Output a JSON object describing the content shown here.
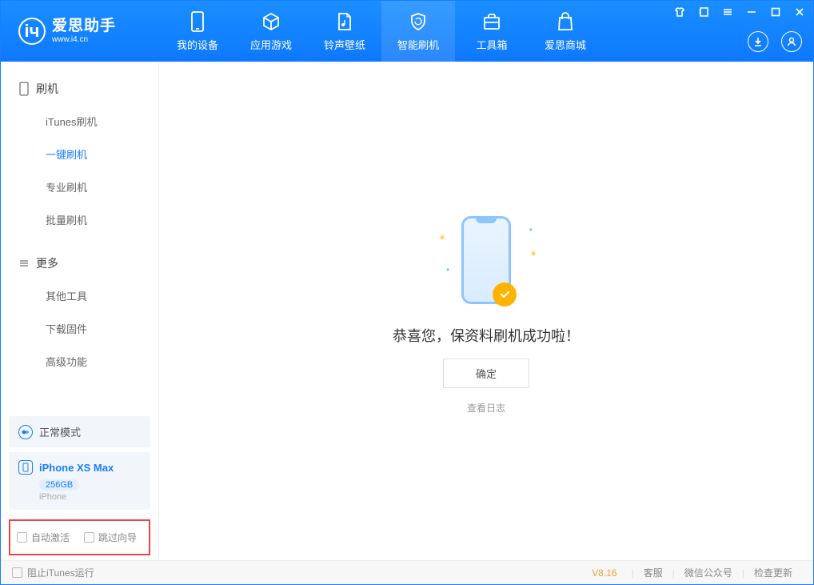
{
  "logo": {
    "title": "爱思助手",
    "sub": "www.i4.cn"
  },
  "tabs": {
    "device": "我的设备",
    "apps": "应用游戏",
    "ringtone": "铃声壁纸",
    "flash": "智能刷机",
    "toolbox": "工具箱",
    "store": "爱思商城"
  },
  "sidebar": {
    "section1_title": "刷机",
    "items1": {
      "itunes": "iTunes刷机",
      "oneclick": "一键刷机",
      "pro": "专业刷机",
      "batch": "批量刷机"
    },
    "section2_title": "更多",
    "items2": {
      "other": "其他工具",
      "firmware": "下载固件",
      "advanced": "高级功能"
    },
    "status_label": "正常模式",
    "device": {
      "name": "iPhone XS Max",
      "capacity": "256GB",
      "type": "iPhone"
    },
    "options": {
      "auto_activate": "自动激活",
      "skip_guide": "跳过向导"
    }
  },
  "main": {
    "success_text": "恭喜您，保资料刷机成功啦！",
    "ok_label": "确定",
    "log_label": "查看日志"
  },
  "footer": {
    "stop_itunes": "阻止iTunes运行",
    "version": "V8.16",
    "links": {
      "service": "客服",
      "wechat": "微信公众号",
      "update": "检查更新"
    }
  }
}
